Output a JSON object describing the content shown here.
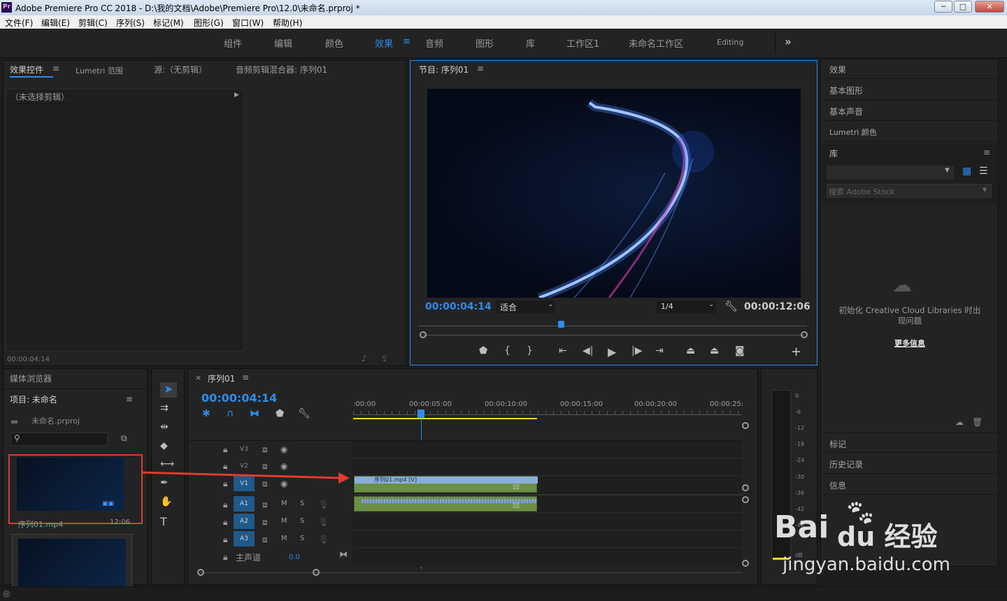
{
  "window": {
    "title": "Adobe Premiere Pro CC 2018 - D:\\我的文档\\Adobe\\Premiere Pro\\12.0\\未命名.prproj *",
    "app_icon": "Pr",
    "min": "─",
    "max": "□",
    "close": "✕"
  },
  "menu": [
    "文件(F)",
    "编辑(E)",
    "剪辑(C)",
    "序列(S)",
    "标记(M)",
    "图形(G)",
    "窗口(W)",
    "帮助(H)"
  ],
  "workspaces": [
    "组件",
    "编辑",
    "颜色",
    "效果",
    "音频",
    "图形",
    "库",
    "工作区1",
    "未命名工作区",
    "Editing"
  ],
  "workspace_more": "»",
  "source_panel": {
    "tabs": [
      "效果控件",
      "Lumetri 范围",
      "源:（无剪辑）",
      "音频剪辑混合器: 序列01"
    ],
    "no_clip": "（未选择剪辑）",
    "timecode": "00:00:04:14"
  },
  "program": {
    "title": "节目: 序列01",
    "timecode": "00:00:04:14",
    "fit": "适合",
    "res": "1/4",
    "duration": "00:00:12:06"
  },
  "right": {
    "items": [
      "效果",
      "基本图形",
      "基本声音",
      "Lumetri 颜色"
    ],
    "library": "库",
    "search_placeholder": "搜索 Adobe Stock",
    "cc_error": "初始化 Creative Cloud Libraries 时出现问题",
    "more_info": "更多信息",
    "bottom_items": [
      "标记",
      "历史记录",
      "信息"
    ]
  },
  "project": {
    "tabs": [
      "媒体浏览器"
    ],
    "title": "项目: 未命名",
    "file": "未命名.prproj",
    "clip_name": "序列01.mp4",
    "clip_dur": "12:06"
  },
  "timeline": {
    "tab": "序列01",
    "timecode": "00:00:04:14",
    "ruler": [
      ":00:00",
      "00:00:05:00",
      "00:00:10:00",
      "00:00:15:00",
      "00:00:20:00",
      "00:00:25:"
    ],
    "tracks": [
      "V3",
      "V2",
      "V1",
      "A1",
      "A2",
      "A3"
    ],
    "master": "主声道",
    "master_val": "0.0",
    "clip_label": "序列01.mp4 [V]"
  },
  "meter": [
    "0",
    "-6",
    "-12",
    "-18",
    "-24",
    "-30",
    "-36",
    "-42",
    "-48",
    "dB"
  ],
  "watermark": {
    "line1": "Bai",
    "line2": "du 经验",
    "url": "jingyan.baidu.com"
  }
}
